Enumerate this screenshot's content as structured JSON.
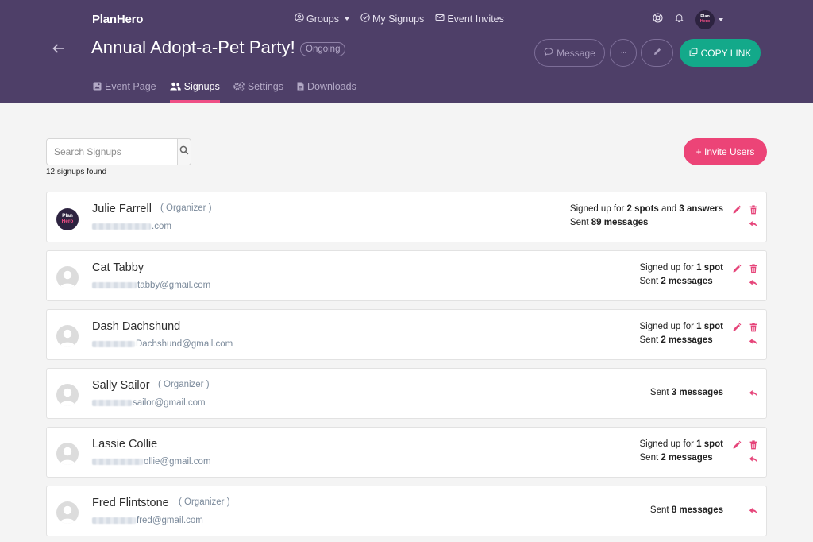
{
  "app": {
    "logo": "PlanHero"
  },
  "topnav": [
    {
      "label": "Groups",
      "icon": "groups-icon",
      "dropdown": true
    },
    {
      "label": "My Signups",
      "icon": "check-circle-icon",
      "dropdown": false
    },
    {
      "label": "Event Invites",
      "icon": "envelope-icon",
      "dropdown": false
    }
  ],
  "user_avatar": {
    "line1": "Plan",
    "line2": "Hero"
  },
  "event": {
    "title": "Annual Adopt-a-Pet Party!",
    "status": "Ongoing"
  },
  "header_actions": {
    "message": "Message",
    "more": "···",
    "copy_link": "COPY LINK"
  },
  "tabs": [
    {
      "label": "Event Page",
      "icon": "event-page-icon",
      "active": false
    },
    {
      "label": "Signups",
      "icon": "users-icon",
      "active": true
    },
    {
      "label": "Settings",
      "icon": "gears-icon",
      "active": false
    },
    {
      "label": "Downloads",
      "icon": "file-icon",
      "active": false
    }
  ],
  "search": {
    "placeholder": "Search Signups",
    "value": ""
  },
  "results_count": "12 signups found",
  "invite_button": "+ Invite Users",
  "colors": {
    "header_bg": "#4e3f68",
    "accent_pink": "#ec4477",
    "accent_green": "#13a98a"
  },
  "signups": [
    {
      "name": "Julie Farrell",
      "role": "( Organizer )",
      "email_visible": ".com",
      "avatar": "planhero",
      "line1": [
        {
          "t": "Signed up for "
        },
        {
          "b": "2 spots"
        },
        {
          "t": " and "
        },
        {
          "b": "3 answers"
        }
      ],
      "line2": [
        {
          "t": "Sent "
        },
        {
          "b": "89 messages"
        }
      ]
    },
    {
      "name": "Cat Tabby",
      "role": "",
      "email_visible": "tabby@gmail.com",
      "avatar": "default",
      "line1": [
        {
          "t": "Signed up for "
        },
        {
          "b": "1 spot"
        }
      ],
      "line2": [
        {
          "t": "Sent "
        },
        {
          "b": "2 messages"
        }
      ]
    },
    {
      "name": "Dash Dachshund",
      "role": "",
      "email_visible": "Dachshund@gmail.com",
      "avatar": "default",
      "line1": [
        {
          "t": "Signed up for "
        },
        {
          "b": "1 spot"
        }
      ],
      "line2": [
        {
          "t": "Sent "
        },
        {
          "b": "2 messages"
        }
      ]
    },
    {
      "name": "Sally Sailor",
      "role": "( Organizer )",
      "email_visible": "sailor@gmail.com",
      "avatar": "default",
      "line1": [],
      "line2": [
        {
          "t": "Sent "
        },
        {
          "b": "3 messages"
        }
      ]
    },
    {
      "name": "Lassie Collie",
      "role": "",
      "email_visible": "ollie@gmail.com",
      "avatar": "default",
      "line1": [
        {
          "t": "Signed up for "
        },
        {
          "b": "1 spot"
        }
      ],
      "line2": [
        {
          "t": "Sent "
        },
        {
          "b": "2 messages"
        }
      ]
    },
    {
      "name": "Fred Flintstone",
      "role": "( Organizer )",
      "email_visible": "fred@gmail.com",
      "avatar": "default",
      "line1": [],
      "line2": [
        {
          "t": "Sent "
        },
        {
          "b": "8 messages"
        }
      ]
    }
  ]
}
